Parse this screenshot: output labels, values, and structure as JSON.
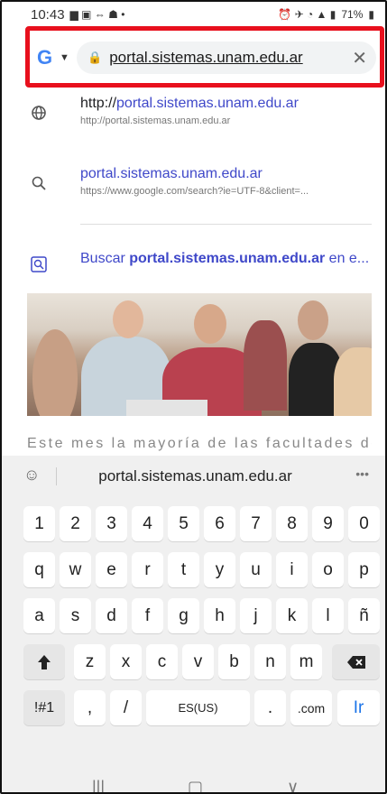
{
  "status": {
    "time": "10:43",
    "battery": "71%"
  },
  "urlbar": {
    "url": "portal.sistemas.unam.edu.ar",
    "clear": "✕"
  },
  "suggestions": [
    {
      "icon": "globe-icon",
      "line1_prefix": "http://",
      "line1_highlight": "portal.sistemas.unam.edu.ar",
      "line2": "http://portal.sistemas.unam.edu.ar"
    },
    {
      "icon": "search-icon",
      "line1_prefix": "",
      "line1_highlight": "portal.sistemas.unam.edu.ar",
      "line2": "https://www.google.com/search?ie=UTF-8&client=..."
    }
  ],
  "buscar": {
    "prefix": "Buscar ",
    "bold": "portal.sistemas.unam.edu.ar",
    "suffix": " en e..."
  },
  "page": {
    "caption": "Este mes la mayoría de las facultades de la"
  },
  "keyboard": {
    "suggestion": "portal.sistemas.unam.edu.ar",
    "row_numbers": [
      "1",
      "2",
      "3",
      "4",
      "5",
      "6",
      "7",
      "8",
      "9",
      "0"
    ],
    "row_q": [
      "q",
      "w",
      "e",
      "r",
      "t",
      "y",
      "u",
      "i",
      "o",
      "p"
    ],
    "row_a": [
      "a",
      "s",
      "d",
      "f",
      "g",
      "h",
      "j",
      "k",
      "l",
      "ñ"
    ],
    "row_z": [
      "z",
      "x",
      "c",
      "v",
      "b",
      "n",
      "m"
    ],
    "sym": "!#1",
    "comma": ",",
    "slash": "/",
    "space": "ES(US)",
    "period": ".",
    "com": ".com",
    "go": "Ir"
  },
  "colors": {
    "highlight": "#e8101d",
    "link": "#3f48c9"
  }
}
